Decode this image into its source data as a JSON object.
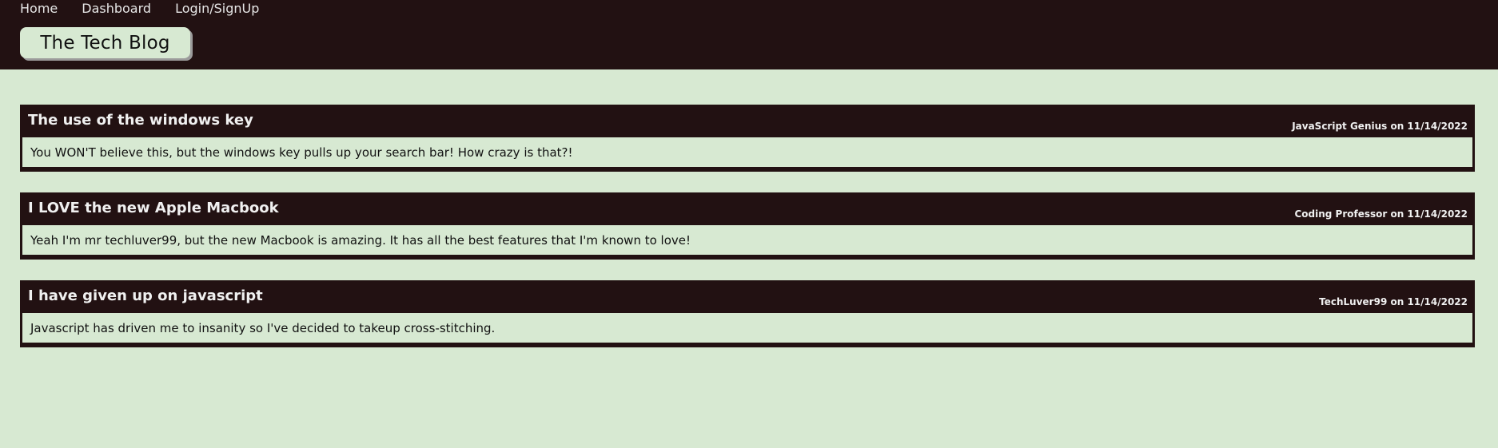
{
  "nav": {
    "items": [
      {
        "label": "Home"
      },
      {
        "label": "Dashboard"
      },
      {
        "label": "Login/SignUp"
      }
    ]
  },
  "brand": {
    "title": "The Tech Blog"
  },
  "posts": [
    {
      "title": "The use of the windows key",
      "meta": "JavaScript Genius on 11/14/2022",
      "body": "You WON'T believe this, but the windows key pulls up your search bar! How crazy is that?!"
    },
    {
      "title": "I LOVE the new Apple Macbook",
      "meta": "Coding Professor on 11/14/2022",
      "body": "Yeah I'm mr techluver99, but the new Macbook is amazing. It has all the best features that I'm known to love!"
    },
    {
      "title": "I have given up on javascript",
      "meta": "TechLuver99 on 11/14/2022",
      "body": "Javascript has driven me to insanity so I've decided to takeup cross-stitching."
    }
  ]
}
